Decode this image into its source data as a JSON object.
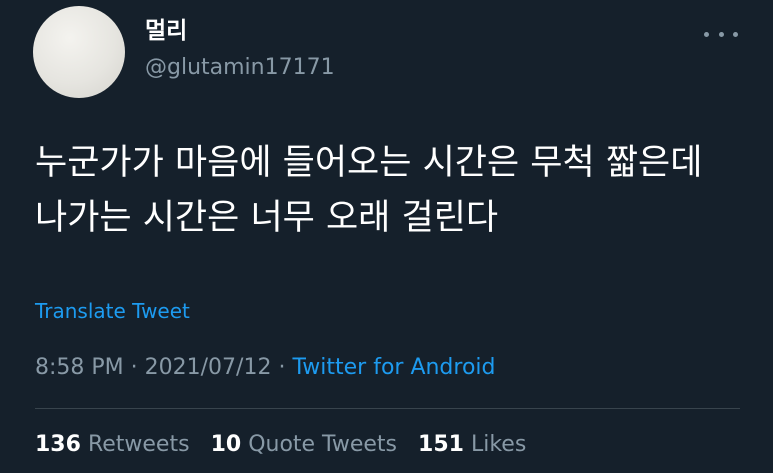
{
  "author": {
    "display_name": "멀리",
    "handle": "@glutamin17171"
  },
  "tweet": {
    "text": "누군가가 마음에 들어오는 시간은 무척 짧은데 나가는 시간은 너무 오래 걸린다",
    "translate_label": "Translate Tweet",
    "time": "8:58 PM",
    "date": "2021/07/12",
    "separator": "·",
    "source": "Twitter for Android"
  },
  "stats": {
    "retweets_count": "136",
    "retweets_label": "Retweets",
    "quotes_count": "10",
    "quotes_label": "Quote Tweets",
    "likes_count": "151",
    "likes_label": "Likes"
  },
  "icons": {
    "more": "more-horizontal-icon"
  },
  "colors": {
    "background": "#15202b",
    "text": "#ffffff",
    "secondary": "#8899a6",
    "link": "#1d9bf0"
  }
}
